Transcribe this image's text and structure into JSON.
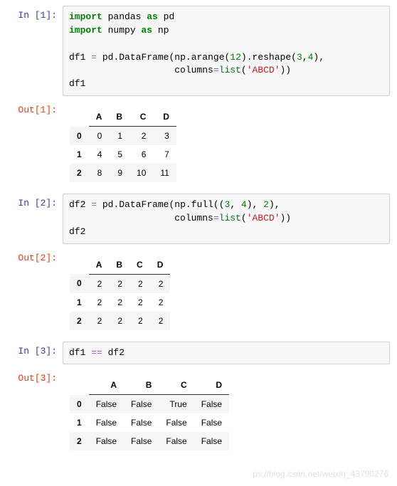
{
  "cells": [
    {
      "in_prompt": "In  [1]:",
      "out_prompt": "Out[1]:",
      "code_tokens": [
        {
          "t": "import",
          "c": "kw-green"
        },
        {
          "t": " pandas "
        },
        {
          "t": "as",
          "c": "kw-green"
        },
        {
          "t": " pd\n"
        },
        {
          "t": "import",
          "c": "kw-green"
        },
        {
          "t": " numpy "
        },
        {
          "t": "as",
          "c": "kw-green"
        },
        {
          "t": " np\n\n"
        },
        {
          "t": "df1 "
        },
        {
          "t": "=",
          "c": "kw-purple"
        },
        {
          "t": " pd"
        },
        {
          "t": "."
        },
        {
          "t": "DataFrame(np"
        },
        {
          "t": "."
        },
        {
          "t": "arange("
        },
        {
          "t": "12",
          "c": "num-green"
        },
        {
          "t": ")"
        },
        {
          "t": "."
        },
        {
          "t": "reshape("
        },
        {
          "t": "3",
          "c": "num-green"
        },
        {
          "t": ","
        },
        {
          "t": "4",
          "c": "num-green"
        },
        {
          "t": "),\n"
        },
        {
          "t": "                   columns"
        },
        {
          "t": "=",
          "c": "kw-purple"
        },
        {
          "t": "list",
          "c": "builtin"
        },
        {
          "t": "("
        },
        {
          "t": "'ABCD'",
          "c": "str-red"
        },
        {
          "t": "))\n"
        },
        {
          "t": "df1"
        }
      ],
      "table": {
        "columns": [
          "A",
          "B",
          "C",
          "D"
        ],
        "index": [
          "0",
          "1",
          "2"
        ],
        "rows": [
          [
            "0",
            "1",
            "2",
            "3"
          ],
          [
            "4",
            "5",
            "6",
            "7"
          ],
          [
            "8",
            "9",
            "10",
            "11"
          ]
        ]
      }
    },
    {
      "in_prompt": "In  [2]:",
      "out_prompt": "Out[2]:",
      "code_tokens": [
        {
          "t": "df2 "
        },
        {
          "t": "=",
          "c": "kw-purple"
        },
        {
          "t": " pd"
        },
        {
          "t": "."
        },
        {
          "t": "DataFrame(np"
        },
        {
          "t": "."
        },
        {
          "t": "full(("
        },
        {
          "t": "3",
          "c": "num-green"
        },
        {
          "t": ", "
        },
        {
          "t": "4",
          "c": "num-green"
        },
        {
          "t": "), "
        },
        {
          "t": "2",
          "c": "num-green"
        },
        {
          "t": "),\n"
        },
        {
          "t": "                   columns"
        },
        {
          "t": "=",
          "c": "kw-purple"
        },
        {
          "t": "list",
          "c": "builtin"
        },
        {
          "t": "("
        },
        {
          "t": "'ABCD'",
          "c": "str-red"
        },
        {
          "t": "))\n"
        },
        {
          "t": "df2"
        }
      ],
      "table": {
        "columns": [
          "A",
          "B",
          "C",
          "D"
        ],
        "index": [
          "0",
          "1",
          "2"
        ],
        "rows": [
          [
            "2",
            "2",
            "2",
            "2"
          ],
          [
            "2",
            "2",
            "2",
            "2"
          ],
          [
            "2",
            "2",
            "2",
            "2"
          ]
        ]
      }
    },
    {
      "in_prompt": "In  [3]:",
      "out_prompt": "Out[3]:",
      "code_tokens": [
        {
          "t": "df1 "
        },
        {
          "t": "==",
          "c": "kw-purple"
        },
        {
          "t": " df2"
        }
      ],
      "table": {
        "columns": [
          "A",
          "B",
          "C",
          "D"
        ],
        "index": [
          "0",
          "1",
          "2"
        ],
        "rows": [
          [
            "False",
            "False",
            "True",
            "False"
          ],
          [
            "False",
            "False",
            "False",
            "False"
          ],
          [
            "False",
            "False",
            "False",
            "False"
          ]
        ]
      }
    }
  ],
  "watermark": "ps://blog.csdn.net/weixin_43790276"
}
